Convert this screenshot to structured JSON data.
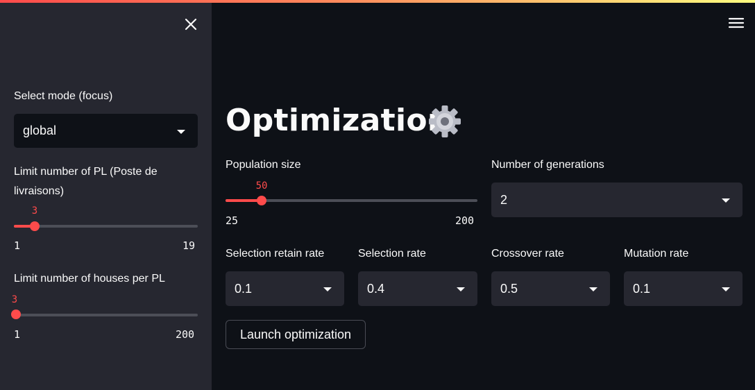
{
  "sidebar": {
    "mode": {
      "label": "Select mode (focus)",
      "value": "global"
    },
    "pl_limit": {
      "label_line1": "Limit number of PL (Poste de",
      "label_line2": "livraisons)",
      "value": "3",
      "min": "1",
      "max": "19"
    },
    "houses_limit": {
      "label": "Limit number of houses per PL",
      "value": "3",
      "min": "1",
      "max": "200"
    }
  },
  "main": {
    "title": "Optimization",
    "population": {
      "label": "Population size",
      "value": "50",
      "min": "25",
      "max": "200"
    },
    "generations": {
      "label": "Number of generations",
      "value": "2"
    },
    "retain": {
      "label": "Selection retain rate",
      "value": "0.1"
    },
    "selection": {
      "label": "Selection rate",
      "value": "0.4"
    },
    "crossover": {
      "label": "Crossover rate",
      "value": "0.5"
    },
    "mutation": {
      "label": "Mutation rate",
      "value": "0.1"
    },
    "launch_label": "Launch optimization"
  },
  "colors": {
    "accent": "#ff4b4b",
    "background": "#0e1117",
    "sidebar": "#262730"
  },
  "icons": {
    "close": "close-icon",
    "menu": "hamburger-menu-icon",
    "gear": "gear-icon"
  }
}
